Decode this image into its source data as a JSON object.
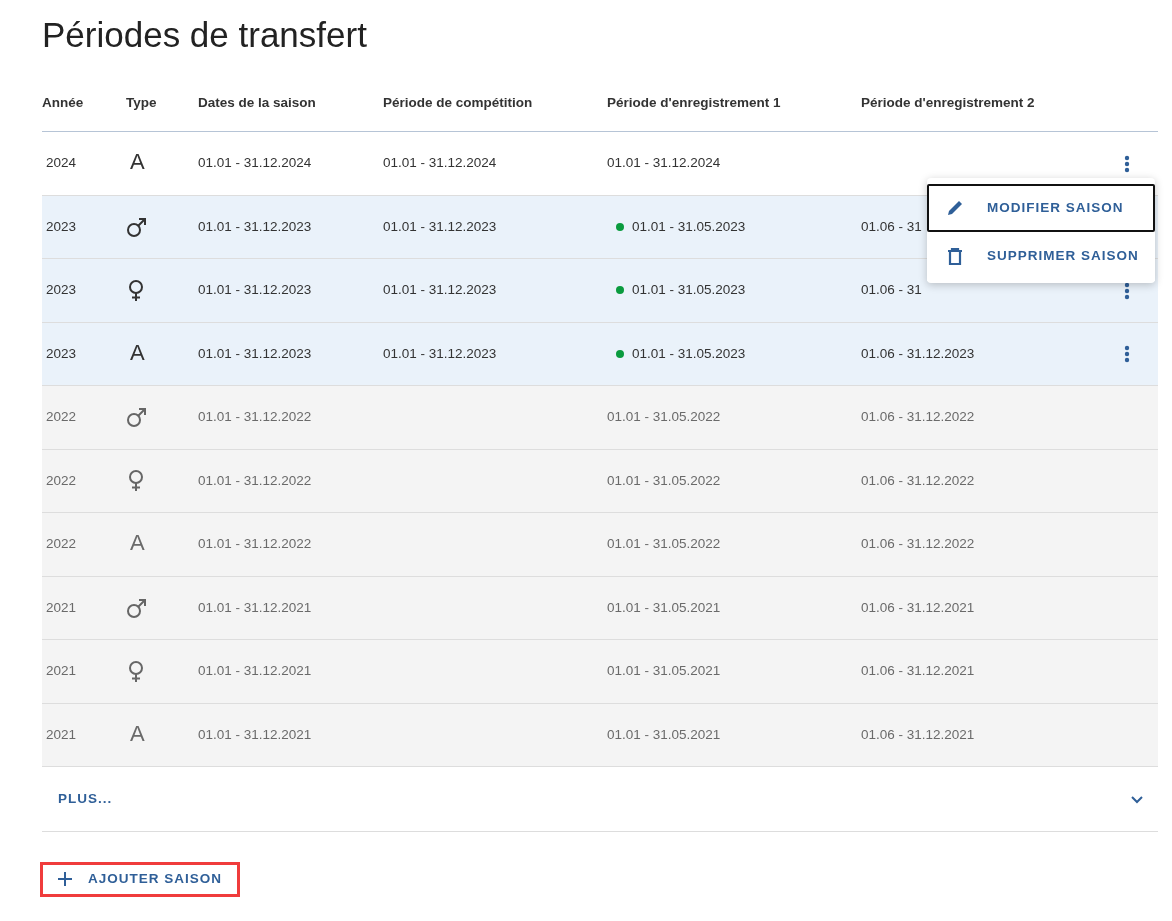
{
  "title": "Périodes de transfert",
  "columns": [
    "Année",
    "Type",
    "Dates de la saison",
    "Période de compétition",
    "Période d'enregistrement 1",
    "Période d'enregistrement 2"
  ],
  "rows": [
    {
      "current": false,
      "past": false,
      "year": "2024",
      "type": {
        "kind": "letter",
        "text": "A"
      },
      "season": "01.01 - 31.12.2024",
      "competition": "01.01 - 31.12.2024",
      "registration_1": {
        "text": "01.01 - 31.12.2024",
        "active": false
      },
      "registration_2": "",
      "menu_button": true
    },
    {
      "current": true,
      "past": false,
      "year": "2023",
      "type": {
        "kind": "male"
      },
      "season": "01.01 - 31.12.2023",
      "competition": "01.01 - 31.12.2023",
      "registration_1": {
        "text": "01.01 - 31.05.2023",
        "active": true
      },
      "registration_2": "01.06 - 31",
      "menu_button": false
    },
    {
      "current": true,
      "past": false,
      "year": "2023",
      "type": {
        "kind": "female"
      },
      "season": "01.01 - 31.12.2023",
      "competition": "01.01 - 31.12.2023",
      "registration_1": {
        "text": "01.01 - 31.05.2023",
        "active": true
      },
      "registration_2": "01.06 - 31",
      "menu_button": true
    },
    {
      "current": true,
      "past": false,
      "year": "2023",
      "type": {
        "kind": "letter",
        "text": "A"
      },
      "season": "01.01 - 31.12.2023",
      "competition": "01.01 - 31.12.2023",
      "registration_1": {
        "text": "01.01 - 31.05.2023",
        "active": true
      },
      "registration_2": "01.06 - 31.12.2023",
      "menu_button": true
    },
    {
      "current": false,
      "past": true,
      "year": "2022",
      "type": {
        "kind": "male"
      },
      "season": "01.01 - 31.12.2022",
      "competition": "",
      "registration_1": {
        "text": "01.01 - 31.05.2022",
        "active": false
      },
      "registration_2": "01.06 - 31.12.2022",
      "menu_button": false
    },
    {
      "current": false,
      "past": true,
      "year": "2022",
      "type": {
        "kind": "female"
      },
      "season": "01.01 - 31.12.2022",
      "competition": "",
      "registration_1": {
        "text": "01.01 - 31.05.2022",
        "active": false
      },
      "registration_2": "01.06 - 31.12.2022",
      "menu_button": false
    },
    {
      "current": false,
      "past": true,
      "year": "2022",
      "type": {
        "kind": "letter",
        "text": "A"
      },
      "season": "01.01 - 31.12.2022",
      "competition": "",
      "registration_1": {
        "text": "01.01 - 31.05.2022",
        "active": false
      },
      "registration_2": "01.06 - 31.12.2022",
      "menu_button": false
    },
    {
      "current": false,
      "past": true,
      "year": "2021",
      "type": {
        "kind": "male"
      },
      "season": "01.01 - 31.12.2021",
      "competition": "",
      "registration_1": {
        "text": "01.01 - 31.05.2021",
        "active": false
      },
      "registration_2": "01.06 - 31.12.2021",
      "menu_button": false
    },
    {
      "current": false,
      "past": true,
      "year": "2021",
      "type": {
        "kind": "female"
      },
      "season": "01.01 - 31.12.2021",
      "competition": "",
      "registration_1": {
        "text": "01.01 - 31.05.2021",
        "active": false
      },
      "registration_2": "01.06 - 31.12.2021",
      "menu_button": false
    },
    {
      "current": false,
      "past": true,
      "year": "2021",
      "type": {
        "kind": "letter",
        "text": "A"
      },
      "season": "01.01 - 31.12.2021",
      "competition": "",
      "registration_1": {
        "text": "01.01 - 31.05.2021",
        "active": false
      },
      "registration_2": "01.06 - 31.12.2021",
      "menu_button": false
    }
  ],
  "more": {
    "label": "PLUS...",
    "expanded": false
  },
  "add_button": {
    "label": "AJOUTER SAISON",
    "highlighted": true
  },
  "context_menu": {
    "items": [
      {
        "kind": "edit",
        "label": "MODIFIER SAISON",
        "focused": true
      },
      {
        "kind": "delete",
        "label": "SUPPRIMER SAISON",
        "focused": false
      }
    ]
  }
}
